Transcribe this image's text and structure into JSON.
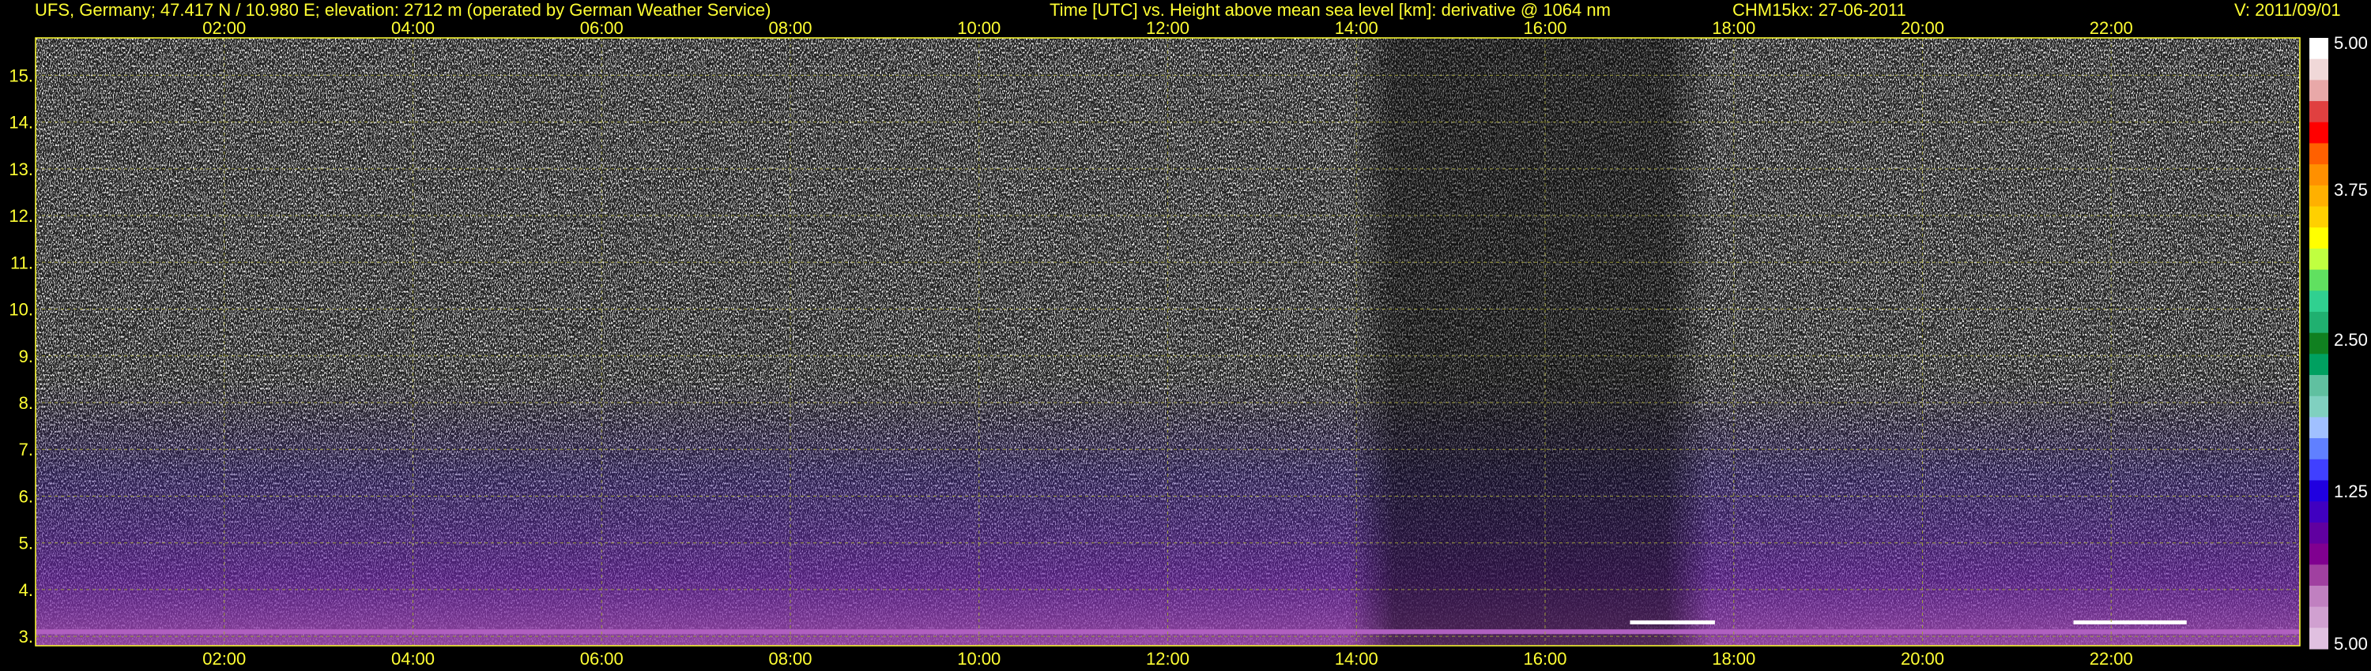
{
  "header": {
    "station": "UFS, Germany; 47.417 N / 10.980 E; elevation: 2712 m  (operated by German Weather Service)",
    "axis_description": "Time [UTC] vs. Height above mean sea level [km]: derivative @ 1064 nm",
    "instrument_date": "CHM15kx: 27-06-2011",
    "version": "V: 2011/09/01"
  },
  "chart_data": {
    "type": "heatmap",
    "title": "Time [UTC] vs. Height above mean sea level [km]: derivative @ 1064 nm",
    "x_ticks": [
      "02:00",
      "04:00",
      "06:00",
      "08:00",
      "10:00",
      "12:00",
      "14:00",
      "16:00",
      "18:00",
      "20:00",
      "22:00"
    ],
    "x_tick_hours": [
      2,
      4,
      6,
      8,
      10,
      12,
      14,
      16,
      18,
      20,
      22
    ],
    "xlim_hours": [
      0,
      24
    ],
    "y_ticks": [
      "3.",
      "4.",
      "5.",
      "6.",
      "7.",
      "8.",
      "9.",
      "10.",
      "11.",
      "12.",
      "13.",
      "14.",
      "15."
    ],
    "y_tick_values": [
      3,
      4,
      5,
      6,
      7,
      8,
      9,
      10,
      11,
      12,
      13,
      14,
      15
    ],
    "ylim_km": [
      2.8,
      15.8
    ],
    "grid": true,
    "colorbar": {
      "tick_labels": [
        "5.00",
        "3.75",
        "2.50",
        "1.25",
        "5.00"
      ],
      "tick_values": [
        5.0,
        3.75,
        2.5,
        1.25,
        0
      ],
      "colors": [
        "#ffffff",
        "#f0d8d8",
        "#e8a8a8",
        "#e04040",
        "#ff0000",
        "#ff6000",
        "#ff9000",
        "#ffb000",
        "#ffd000",
        "#ffff00",
        "#c0ff40",
        "#60e060",
        "#30d090",
        "#20b070",
        "#108020",
        "#00a060",
        "#60c0a0",
        "#80d0c0",
        "#a0c0ff",
        "#6080ff",
        "#4040ff",
        "#2000e0",
        "#4000c0",
        "#6000a0",
        "#800090",
        "#a040a0",
        "#c080c0",
        "#d0a0d0",
        "#e0c0e0"
      ]
    },
    "features": [
      {
        "label": "aerosol layer top",
        "start_hour": 0.0,
        "end_hour": 24.0,
        "height_km": 3.1
      },
      {
        "label": "cloud layer",
        "start_hour": 16.9,
        "end_hour": 17.8,
        "height_km": 3.3
      },
      {
        "label": "cloud layer",
        "start_hour": 21.6,
        "end_hour": 22.8,
        "height_km": 3.3
      }
    ]
  },
  "colors": {
    "background": "#000000",
    "text": "#ffff33",
    "grid": "#9a9a3a",
    "noise": "#c8c8c8",
    "aerosol": "#7a2aa0"
  }
}
